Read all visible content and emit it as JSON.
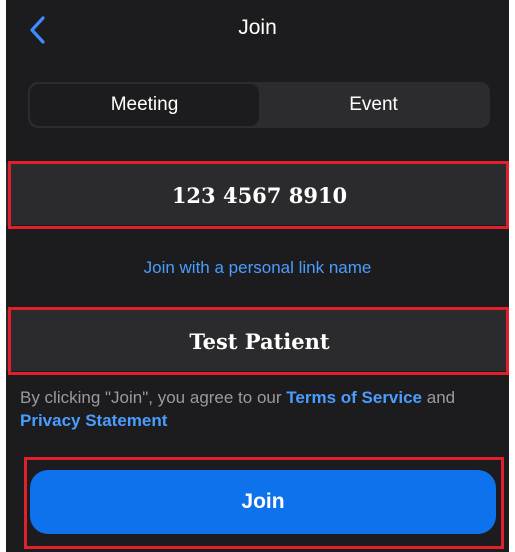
{
  "header": {
    "title": "Join",
    "back_icon": "chevron-left-icon"
  },
  "tabs": [
    {
      "label": "Meeting",
      "selected": true
    },
    {
      "label": "Event",
      "selected": false
    }
  ],
  "meeting_id": {
    "value": "123 4567 8910"
  },
  "personal_link_label": "Join with a personal link name",
  "display_name": {
    "value": "Test Patient"
  },
  "terms": {
    "prefix": "By clicking \"Join\", you agree to our ",
    "terms_link": "Terms of Service",
    "conjunction": " and ",
    "privacy_link": "Privacy Statement"
  },
  "join_button_label": "Join",
  "colors": {
    "accent": "#0e72ed",
    "link": "#4a9dff",
    "highlight": "#e0202a",
    "background": "#1c1c1e"
  }
}
